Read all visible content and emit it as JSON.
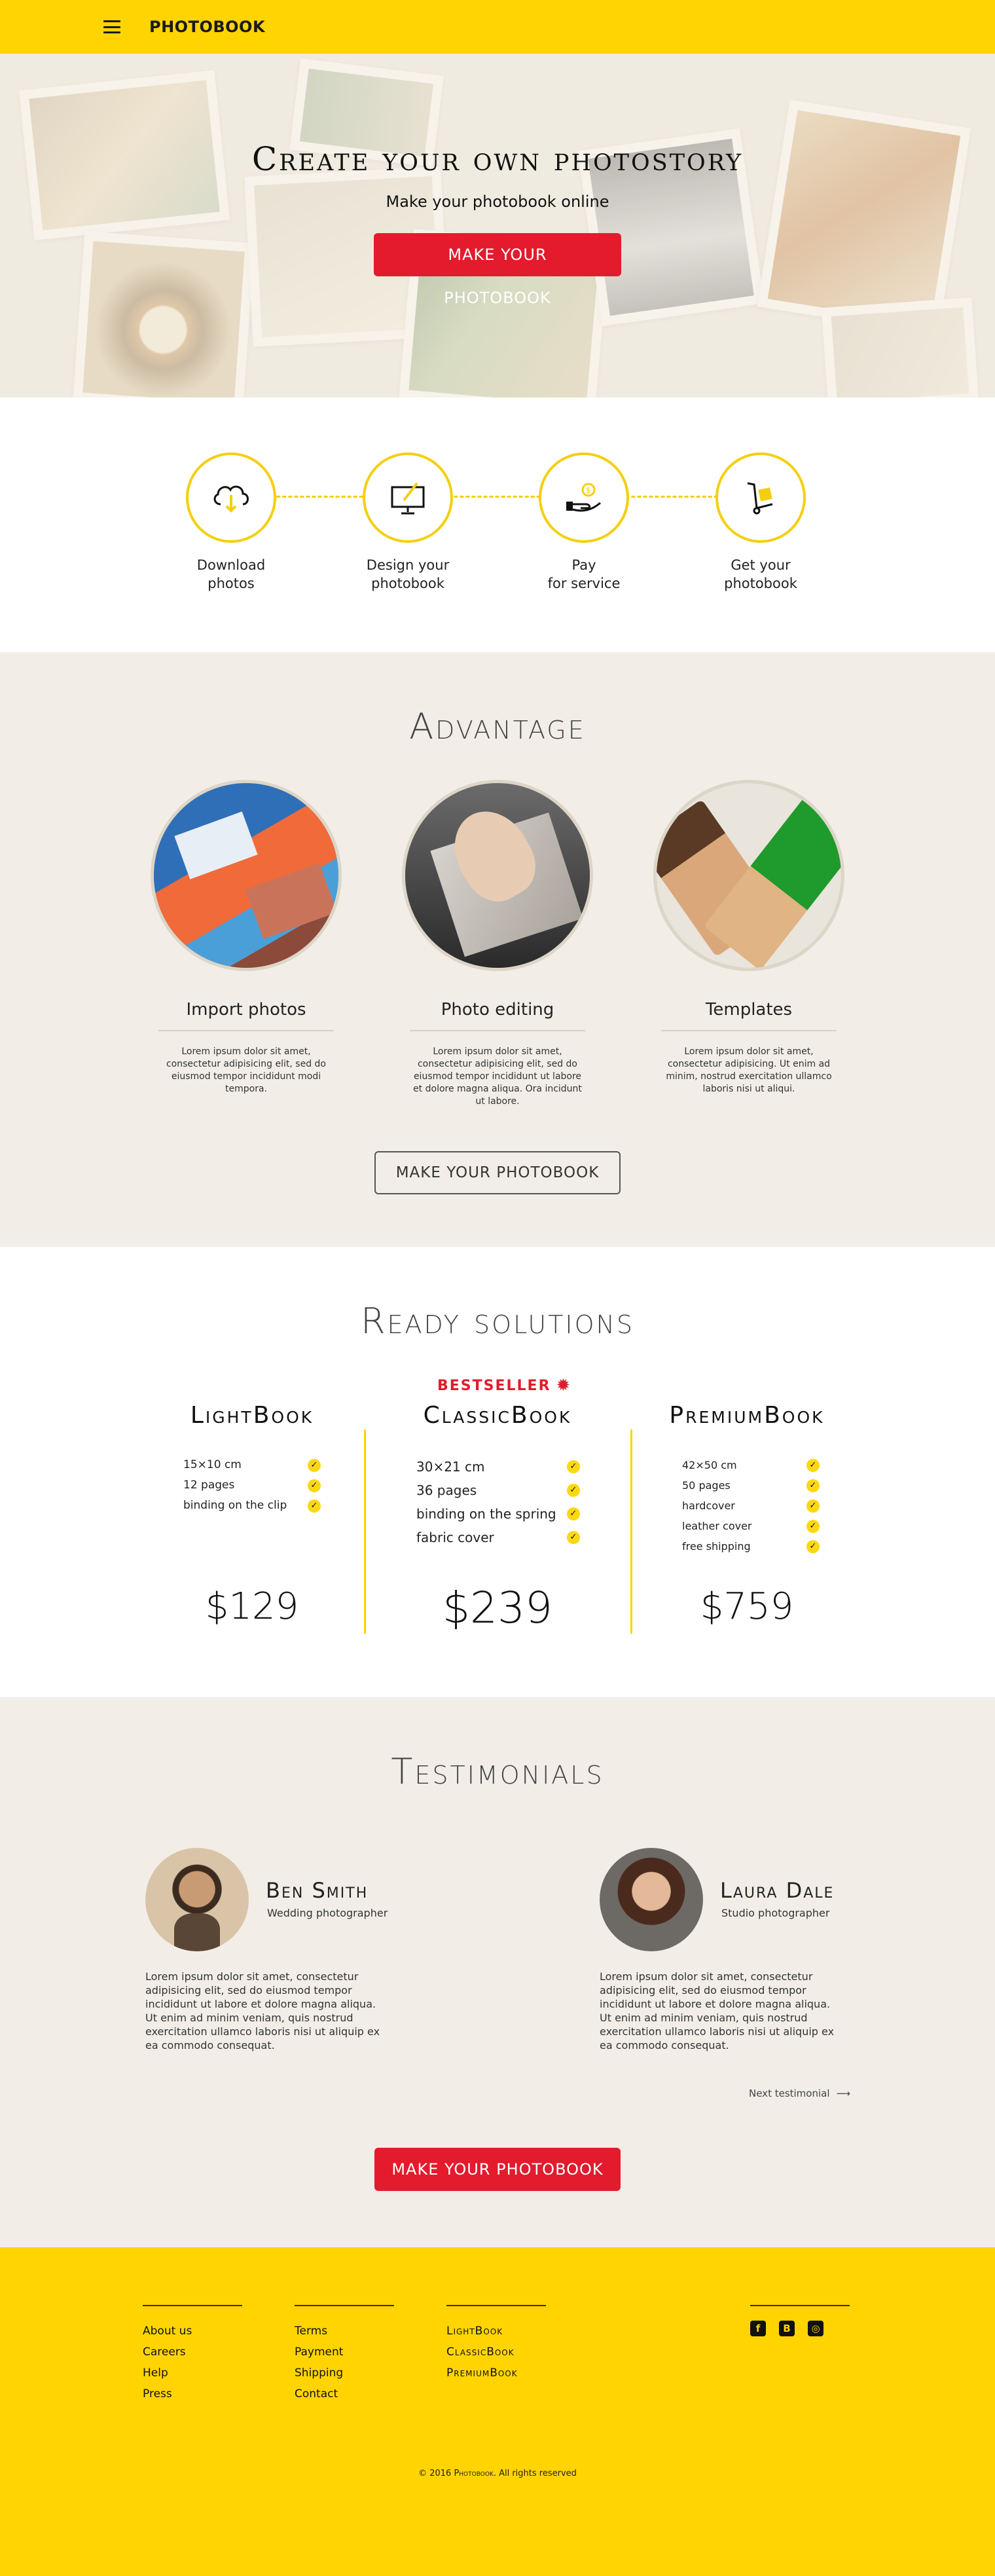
{
  "header": {
    "logo": "PHOTOBOOK"
  },
  "hero": {
    "title": "Create your own photostory",
    "subtitle": "Make your photobook online",
    "cta": "MAKE YOUR PHOTOBOOK"
  },
  "steps": [
    {
      "line1": "Download",
      "line2": "photos",
      "icon": "cloud-upload-icon"
    },
    {
      "line1": "Design your",
      "line2": "photobook",
      "icon": "monitor-design-icon"
    },
    {
      "line1": "Pay",
      "line2": "for service",
      "icon": "hand-coin-icon"
    },
    {
      "line1": "Get your",
      "line2": "photobook",
      "icon": "delivery-cart-icon"
    }
  ],
  "advantage": {
    "title": "Advantage",
    "cards": [
      {
        "name": "Import photos",
        "text": "Lorem ipsum dolor sit amet, consectetur adipisicing elit, sed do eiusmod tempor incididunt modi tempora."
      },
      {
        "name": "Photo editing",
        "text": "Lorem ipsum dolor sit amet, consectetur adipisicing elit, sed do eiusmod tempor incididunt ut labore et dolore magna aliqua. Ora incidunt ut labore."
      },
      {
        "name": "Templates",
        "text": "Lorem ipsum dolor sit amet, consectetur adipisicing. Ut enim ad minim, nostrud exercitation ullamco laboris nisi ut aliqui."
      }
    ],
    "cta": "MAKE YOUR PHOTOBOOK"
  },
  "ready": {
    "title": "Ready solutions",
    "bestseller": "BESTSELLER",
    "plans": [
      {
        "name": "LightBook",
        "features": [
          "15×10 cm",
          "12 pages",
          "binding on the clip"
        ],
        "price": "$129"
      },
      {
        "name": "ClassicBook",
        "features": [
          "30×21 cm",
          "36 pages",
          "binding on the spring",
          "fabric cover"
        ],
        "price": "$239"
      },
      {
        "name": "PremiumBook",
        "features": [
          "42×50 cm",
          "50 pages",
          "hardcover",
          "leather cover",
          "free shipping"
        ],
        "price": "$759"
      }
    ]
  },
  "testimonials": {
    "title": "Testimonials",
    "people": [
      {
        "name": "Ben Smith",
        "role": "Wedding photographer",
        "text": "Lorem ipsum dolor sit amet, consectetur adipisicing elit, sed do eiusmod tempor incididunt ut labore et dolore magna aliqua. Ut enim ad minim veniam, quis nostrud exercitation ullamco laboris nisi ut aliquip ex ea commodo consequat."
      },
      {
        "name": "Laura Dale",
        "role": "Studio photographer",
        "text": "Lorem ipsum dolor sit amet, consectetur adipisicing elit, sed do eiusmod tempor incididunt ut labore et dolore magna aliqua. Ut enim ad minim veniam, quis nostrud exercitation ullamco laboris nisi ut aliquip ex ea commodo consequat."
      }
    ],
    "next": "Next testimonial",
    "cta": "MAKE YOUR PHOTOBOOK"
  },
  "footer": {
    "col1": [
      "About us",
      "Careers",
      "Help",
      "Press"
    ],
    "col2": [
      "Terms",
      "Payment",
      "Shipping",
      "Contact"
    ],
    "col3": [
      "LightBook",
      "ClassicBook",
      "PremiumBook"
    ],
    "social": [
      "facebook-icon",
      "behance-icon",
      "instagram-icon"
    ],
    "copyright_prefix": "© 2016",
    "copyright_brand": "Photobook",
    "copyright_suffix": ". All rights reserved"
  },
  "colors": {
    "brand_yellow": "#ffd400",
    "accent_red": "#e31b2d",
    "section_beige": "#f2eee7"
  }
}
